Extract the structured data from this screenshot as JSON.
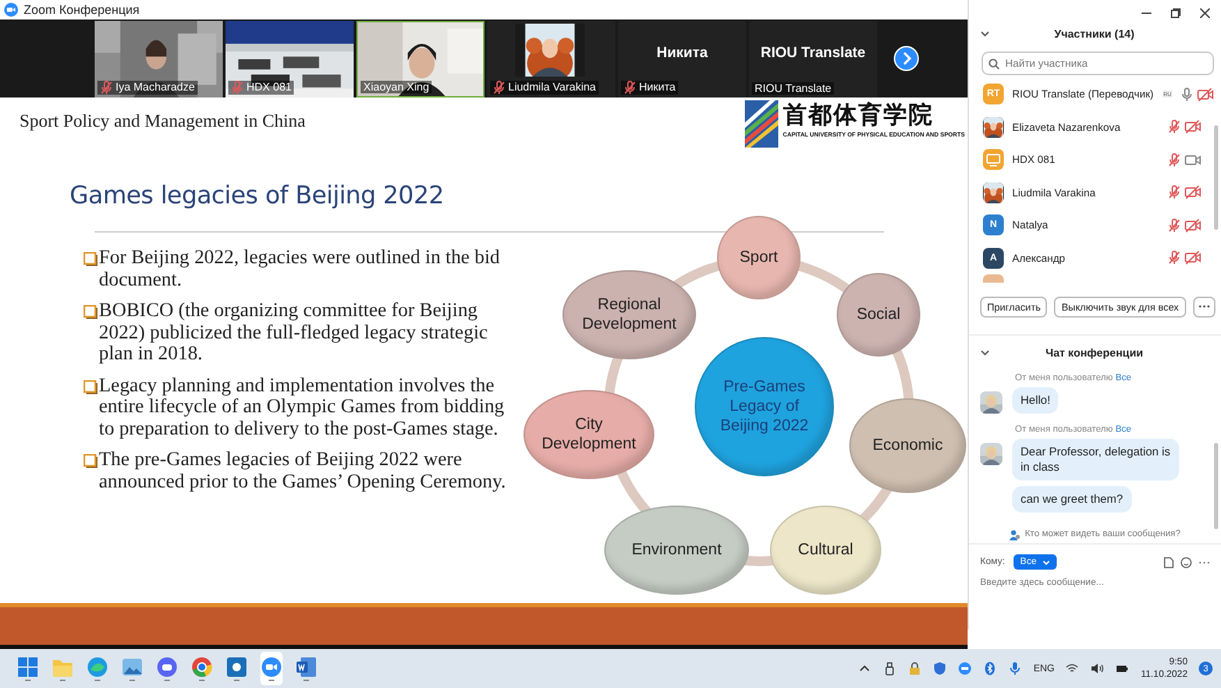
{
  "window": {
    "title": "Zoom Конференция"
  },
  "video_strip": {
    "tiles": [
      {
        "kind": "video",
        "name": "Iya Macharadze",
        "muted": true,
        "speaking": false
      },
      {
        "kind": "video",
        "name": "HDX 081",
        "muted": true,
        "speaking": false
      },
      {
        "kind": "video",
        "name": "Xiaoyan Xing",
        "muted": false,
        "speaking": true
      },
      {
        "kind": "avatar",
        "name": "Liudmila Varakina",
        "muted": true,
        "speaking": false
      },
      {
        "kind": "name",
        "display_name": "Никита",
        "name": "Никита",
        "muted": true,
        "speaking": false
      },
      {
        "kind": "name",
        "display_name": "RIOU Translate",
        "name": "RIOU Translate",
        "muted": false,
        "speaking": false
      }
    ]
  },
  "slide": {
    "header": "Sport Policy and Management in China",
    "logo_text": "首都体育学院",
    "logo_caption": "CAPITAL UNIVERSITY OF PHYSICAL EDUCATION AND SPORTS",
    "title": "Games legacies of Beijing 2022",
    "bullets": [
      "For Beijing 2022, legacies were outlined in the bid document.",
      "BOBICO (the organizing committee for Beijing 2022) publicized the full-fledged legacy strategic plan in 2018.",
      "Legacy planning and implementation involves the entire lifecycle of an Olympic Games from bidding to preparation to delivery to the post-Games stage.",
      "The pre-Games legacies of Beijing 2022 were announced prior to the Games’ Opening Ceremony."
    ],
    "diagram": {
      "center": "Pre-Games Legacy of Beijing 2022",
      "nodes": [
        {
          "label": "Sport",
          "color": "#e7b6ae"
        },
        {
          "label": "Social",
          "color": "#cdb3b0"
        },
        {
          "label": "Economic",
          "color": "#cfbfb1"
        },
        {
          "label": "Cultural",
          "color": "#ede6c9"
        },
        {
          "label": "Environment",
          "color": "#c5ccc4"
        },
        {
          "label": "City Development",
          "color": "#e6aca7"
        },
        {
          "label": "Regional Development",
          "color": "#cbb2ae"
        }
      ]
    }
  },
  "participants": {
    "title": "Участники (14)",
    "search": {
      "placeholder": "Найти участника"
    },
    "list": [
      {
        "name": "RIOU Translate (Переводчик)",
        "kind": "initials",
        "initials": "RT",
        "color": "#f2a531",
        "badge": "RU",
        "mic_muted": false,
        "video_off": true
      },
      {
        "name": "Elizaveta Nazarenkova",
        "mic_muted": true,
        "video_off": true
      },
      {
        "name": "HDX 081",
        "kind": "device",
        "color": "#f2a531",
        "mic_muted": true,
        "video_off": false
      },
      {
        "name": "Liudmila Varakina",
        "mic_muted": true,
        "video_off": true
      },
      {
        "name": "Natalya",
        "kind": "initials",
        "initials": "N",
        "color": "#2d7fcf",
        "mic_muted": true,
        "video_off": true
      },
      {
        "name": "Александр",
        "kind": "initials",
        "initials": "A",
        "color": "#2c4763",
        "mic_muted": true,
        "video_off": true
      }
    ],
    "buttons": [
      "Пригласить",
      "Выключить звук для всех"
    ]
  },
  "chat": {
    "title": "Чат конференции",
    "groups": [
      {
        "header": "От меня пользователю",
        "recipient": "Все",
        "bubbles": [
          "Hello!"
        ]
      },
      {
        "header": "От меня пользователю",
        "recipient": "Все",
        "bubbles": [
          "Dear Professor, delegation is in class",
          "can we greet them?"
        ]
      }
    ],
    "notice": "Кто может видеть ваши сообщения?",
    "to_label": "Кому:",
    "to_value": "Все",
    "input": {
      "placeholder": "Введите здесь сообщение..."
    }
  },
  "taskbar": {
    "language": "ENG",
    "time": "9:50",
    "date": "11.10.2022",
    "notifications": "3"
  }
}
